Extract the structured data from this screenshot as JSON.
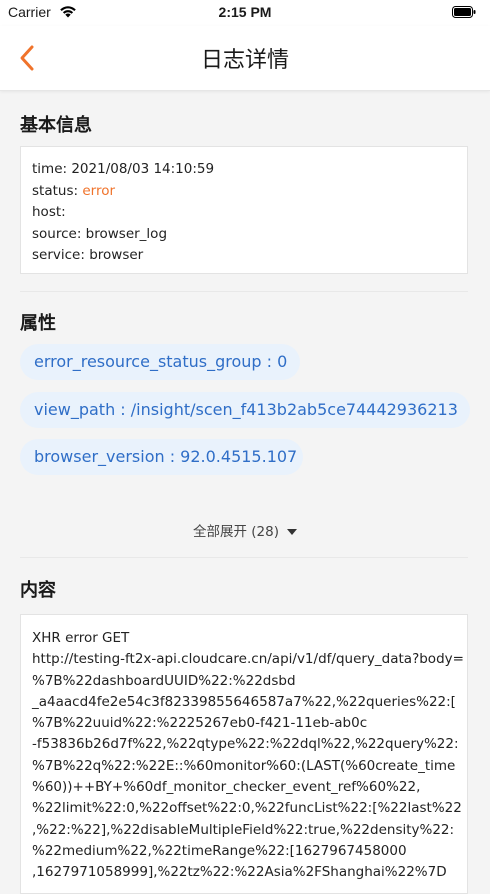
{
  "status_bar": {
    "carrier": "Carrier",
    "time": "2:15 PM"
  },
  "nav": {
    "title": "日志详情"
  },
  "basic_info": {
    "title": "基本信息",
    "lines": [
      {
        "label": "time: ",
        "value": "2021/08/03 14:10:59"
      },
      {
        "label": "status: ",
        "value": "error"
      },
      {
        "label": "host:",
        "value": ""
      },
      {
        "label": "source: ",
        "value": "browser_log"
      },
      {
        "label": "service: ",
        "value": "browser"
      }
    ]
  },
  "attributes": {
    "title": "属性",
    "chips": [
      "error_resource_status_group : 0",
      "view_path : /insight/scen_f413b2ab5ce74442936213",
      "browser_version : 92.0.4515.107"
    ],
    "expand_label": "全部展开 (28)"
  },
  "content": {
    "title": "内容",
    "lines": [
      "XHR error GET",
      "http://testing-ft2x-api.cloudcare.cn/api/v1/df/query_data?body=",
      "%7B%22dashboardUUID%22:%22dsbd",
      "_a4aacd4fe2e54c3f82339855646587a7%22,%22queries%22:[",
      "%7B%22uuid%22:%2225267eb0-f421-11eb-ab0c",
      "-f53836b26d7f%22,%22qtype%22:%22dql%22,%22query%22:",
      "%7B%22q%22:%22E::%60monitor%60:(LAST(%60create_time",
      "%60))++BY+%60df_monitor_checker_event_ref%60%22,",
      "%22limit%22:0,%22offset%22:0,%22funcList%22:[%22last%22",
      ",%22:%22],%22disableMultipleField%22:true,%22density%22:",
      "%22medium%22,%22timeRange%22:[1627967458000",
      ",1627971058999],%22tz%22:%22Asia%2FShanghai%22%7D"
    ]
  },
  "colors": {
    "accent": "#f0732b",
    "chip_text": "#2f6ec7",
    "chip_bg": "#e9f2fc"
  }
}
